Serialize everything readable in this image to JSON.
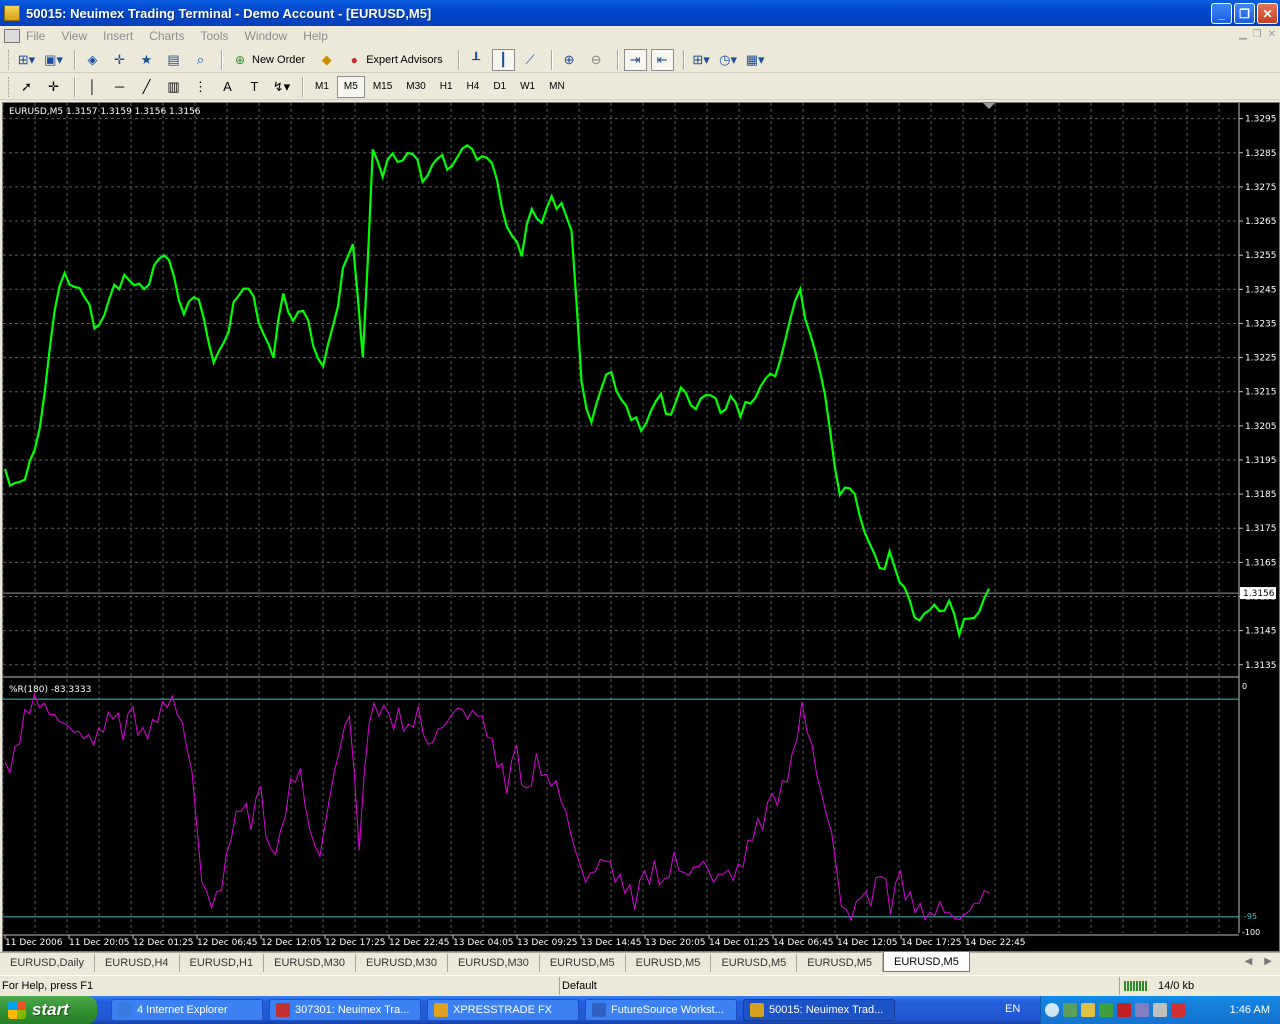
{
  "window": {
    "title": "50015: Neuimex Trading Terminal - Demo Account - [EURUSD,M5]",
    "minimize": "_",
    "restore": "❐",
    "close": "✕"
  },
  "menu": [
    "File",
    "View",
    "Insert",
    "Charts",
    "Tools",
    "Window",
    "Help"
  ],
  "toolbar1": {
    "new_order": "New Order",
    "expert_advisors": "Expert Advisors"
  },
  "timeframes": [
    "M1",
    "M5",
    "M15",
    "M30",
    "H1",
    "H4",
    "D1",
    "W1",
    "MN"
  ],
  "selected_timeframe": "M5",
  "chart": {
    "info": "EURUSD,M5  1.3157 1.3159 1.3156 1.3156",
    "indicator_info": "%R(180) -83.3333",
    "current_price": "1.3156",
    "price_color": "#00ff00",
    "indicator_color": "#e000e0",
    "indicator_upper_label": "0",
    "indicator_lower_label": "-100",
    "indicator_level_label": "-95"
  },
  "chart_data": {
    "type": "line",
    "price_series": {
      "name": "EURUSD,M5",
      "y_ticks": [
        "1.3295",
        "1.3285",
        "1.3275",
        "1.3265",
        "1.3255",
        "1.3245",
        "1.3235",
        "1.3225",
        "1.3215",
        "1.3205",
        "1.3195",
        "1.3185",
        "1.3175",
        "1.3165",
        "1.3155",
        "1.3145",
        "1.3135"
      ],
      "ylim": [
        1.3132,
        1.3299
      ],
      "points": [
        1.3191,
        1.3188,
        1.319,
        1.3197,
        1.3215,
        1.324,
        1.3249,
        1.3246,
        1.3244,
        1.3233,
        1.3238,
        1.3245,
        1.3249,
        1.3247,
        1.3244,
        1.3252,
        1.3256,
        1.3248,
        1.3238,
        1.3244,
        1.3236,
        1.3224,
        1.3228,
        1.3241,
        1.3246,
        1.3242,
        1.3232,
        1.3226,
        1.3243,
        1.3236,
        1.324,
        1.3228,
        1.3223,
        1.3233,
        1.3251,
        1.3259,
        1.3224,
        1.3286,
        1.3279,
        1.3284,
        1.3283,
        1.3286,
        1.3276,
        1.3282,
        1.3283,
        1.3281,
        1.3287,
        1.3285,
        1.3284,
        1.3283,
        1.3268,
        1.3261,
        1.3256,
        1.3268,
        1.3265,
        1.3271,
        1.327,
        1.3263,
        1.3217,
        1.3206,
        1.3217,
        1.322,
        1.3213,
        1.3208,
        1.3203,
        1.321,
        1.3213,
        1.3208,
        1.3217,
        1.321,
        1.3213,
        1.3215,
        1.3208,
        1.3214,
        1.3209,
        1.3211,
        1.3217,
        1.3219,
        1.3224,
        1.3237,
        1.3244,
        1.3232,
        1.3222,
        1.3203,
        1.3185,
        1.3188,
        1.3178,
        1.3171,
        1.3162,
        1.3168,
        1.316,
        1.3153,
        1.3148,
        1.3152,
        1.315,
        1.3154,
        1.3145,
        1.3148,
        1.3151,
        1.3156
      ]
    },
    "indicator_series": {
      "name": "%R(180)",
      "ylim": [
        -100,
        0
      ],
      "levels": [
        -5,
        -95
      ],
      "points": [
        -35,
        -28,
        -12,
        -5,
        -8,
        -12,
        -15,
        -18,
        -20,
        -22,
        -16,
        -10,
        -18,
        -12,
        -20,
        -16,
        -8,
        -5,
        -15,
        -35,
        -80,
        -90,
        -82,
        -60,
        -48,
        -55,
        -45,
        -70,
        -62,
        -40,
        -35,
        -60,
        -70,
        -45,
        -25,
        -10,
        -65,
        -12,
        -8,
        -15,
        -12,
        -18,
        -10,
        -25,
        -18,
        -14,
        -8,
        -12,
        -10,
        -18,
        -30,
        -40,
        -28,
        -45,
        -30,
        -38,
        -40,
        -52,
        -68,
        -80,
        -75,
        -70,
        -78,
        -82,
        -88,
        -80,
        -75,
        -82,
        -70,
        -78,
        -75,
        -72,
        -80,
        -76,
        -78,
        -72,
        -60,
        -55,
        -48,
        -42,
        -30,
        -8,
        -25,
        -45,
        -60,
        -90,
        -95,
        -85,
        -88,
        -75,
        -90,
        -80,
        -88,
        -92,
        -95,
        -90,
        -94,
        -96,
        -92,
        -88,
        -83
      ]
    },
    "x_ticks": [
      "11 Dec 2006",
      "11 Dec 20:05",
      "12 Dec 01:25",
      "12 Dec 06:45",
      "12 Dec 12:05",
      "12 Dec 17:25",
      "12 Dec 22:45",
      "13 Dec 04:05",
      "13 Dec 09:25",
      "13 Dec 14:45",
      "13 Dec 20:05",
      "14 Dec 01:25",
      "14 Dec 06:45",
      "14 Dec 12:05",
      "14 Dec 17:25",
      "14 Dec 22:45"
    ],
    "grid": true
  },
  "tabs": [
    "EURUSD,Daily",
    "EURUSD,H4",
    "EURUSD,H1",
    "EURUSD,M30",
    "EURUSD,M30",
    "EURUSD,M30",
    "EURUSD,M5",
    "EURUSD,M5",
    "EURUSD,M5",
    "EURUSD,M5",
    "EURUSD,M5"
  ],
  "active_tab": 10,
  "status": {
    "help": "For Help, press F1",
    "profile": "Default",
    "traffic": "14/0 kb"
  },
  "taskbar": {
    "start": "start",
    "tasks": [
      {
        "label": "4 Internet Explorer",
        "color": "#3a7be0"
      },
      {
        "label": "307301: Neuimex Tra...",
        "color": "#c03030"
      },
      {
        "label": "XPRESSTRADE FX",
        "color": "#e0a020"
      },
      {
        "label": "FutureSource Workst...",
        "color": "#3060c0"
      },
      {
        "label": "50015: Neuimex Trad...",
        "color": "#d4a020"
      }
    ],
    "lang": "EN",
    "clock": "1:46 AM"
  }
}
